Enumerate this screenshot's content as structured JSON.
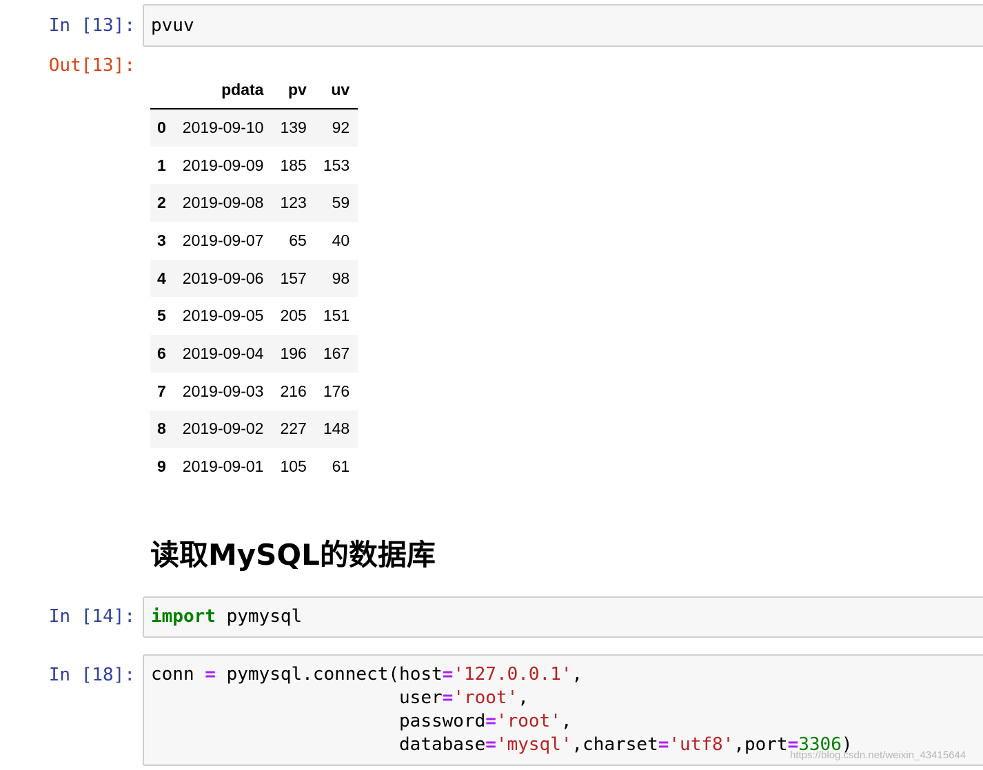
{
  "cells": {
    "c13": {
      "prompt_in": "In [13]:",
      "prompt_out": "Out[13]:",
      "code": "pvuv"
    },
    "c14": {
      "prompt": "In [14]:",
      "kw_import": "import",
      "module": " pymysql"
    },
    "c18": {
      "prompt": "In [18]:",
      "l1": {
        "t1": "conn ",
        "op": "=",
        "t2": " pymysql.connect(host",
        "eq": "=",
        "s": "'127.0.0.1'",
        "t3": ","
      },
      "l2": {
        "pad": "                       ",
        "t1": "user",
        "eq": "=",
        "s": "'root'",
        "t2": ","
      },
      "l3": {
        "pad": "                       ",
        "t1": "password",
        "eq": "=",
        "s": "'root'",
        "t2": ","
      },
      "l4": {
        "pad": "                       ",
        "t1": "database",
        "eq": "=",
        "s": "'mysql'",
        "t2": ",charset",
        "eq2": "=",
        "s2": "'utf8'",
        "t3": ",port",
        "eq3": "=",
        "n": "3306",
        "t4": ")"
      }
    }
  },
  "dataframe": {
    "columns": [
      "pdata",
      "pv",
      "uv"
    ],
    "rows": [
      {
        "idx": "0",
        "pdata": "2019-09-10",
        "pv": "139",
        "uv": "92"
      },
      {
        "idx": "1",
        "pdata": "2019-09-09",
        "pv": "185",
        "uv": "153"
      },
      {
        "idx": "2",
        "pdata": "2019-09-08",
        "pv": "123",
        "uv": "59"
      },
      {
        "idx": "3",
        "pdata": "2019-09-07",
        "pv": "65",
        "uv": "40"
      },
      {
        "idx": "4",
        "pdata": "2019-09-06",
        "pv": "157",
        "uv": "98"
      },
      {
        "idx": "5",
        "pdata": "2019-09-05",
        "pv": "205",
        "uv": "151"
      },
      {
        "idx": "6",
        "pdata": "2019-09-04",
        "pv": "196",
        "uv": "167"
      },
      {
        "idx": "7",
        "pdata": "2019-09-03",
        "pv": "216",
        "uv": "176"
      },
      {
        "idx": "8",
        "pdata": "2019-09-02",
        "pv": "227",
        "uv": "148"
      },
      {
        "idx": "9",
        "pdata": "2019-09-01",
        "pv": "105",
        "uv": "61"
      }
    ]
  },
  "markdown": {
    "heading": "读取MySQL的数据库"
  },
  "watermark": "https://blog.csdn.net/weixin_43415644"
}
